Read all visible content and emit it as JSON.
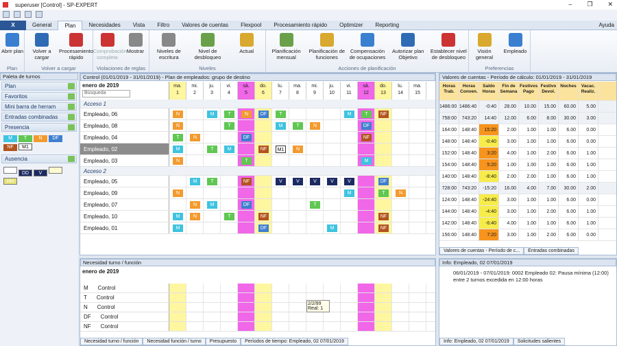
{
  "window": {
    "title": "superuser [Control] - SP-EXPERT"
  },
  "ribbon": {
    "file_label": "X",
    "tabs": [
      "General",
      "Plan",
      "Necesidades",
      "Vista",
      "Filtro",
      "Valores de cuentas",
      "Flexpool",
      "Procesamiento rápido",
      "Optimizer",
      "Reporting"
    ],
    "active_tab": "Plan",
    "help": "Ayuda",
    "groups": [
      {
        "label": "Plan",
        "buttons": [
          "Abrir plan"
        ]
      },
      {
        "label": "Volver a cargar",
        "buttons": [
          "Volver a cargar",
          "Procesamiento rápido"
        ]
      },
      {
        "label": "Violaciones de reglas",
        "buttons": [
          "Comprobación completa",
          "Mostrar"
        ]
      },
      {
        "label": "Niveles",
        "buttons": [
          "Niveles de escritura",
          "Nivel de desbloqueo",
          "Actual"
        ]
      },
      {
        "label": "Acciones de planificación",
        "buttons": [
          "Planificación mensual",
          "Planificación de funciones",
          "Compensación de ocupaciones",
          "Autorizar plan Objetivo",
          "Establecer nivel de desbloqueo"
        ]
      },
      {
        "label": "Preferencias",
        "buttons": [
          "Visión general",
          "Empleado"
        ]
      }
    ]
  },
  "left": {
    "title": "Paleta de turnos",
    "items": [
      "Plan",
      "Favoritos",
      "Mini barra de herram",
      "Entradas combinadas",
      "Presencia",
      "Ausencia"
    ],
    "presence_chips": [
      "M",
      "T",
      "N",
      "DF",
      "NF",
      "M1"
    ],
    "absence_chips": [
      "",
      "DD",
      "V",
      "",
      "HH"
    ]
  },
  "center": {
    "title": "Control (01/01/2019 - 31/01/2019) - Plan de empleados: grupo de destino",
    "month": "enero de 2019",
    "search_placeholder": "Búsqueda",
    "days": [
      [
        "ma.",
        "1"
      ],
      [
        "mi.",
        "2"
      ],
      [
        "ju.",
        "3"
      ],
      [
        "vi.",
        "4"
      ],
      [
        "sá.",
        "5"
      ],
      [
        "do.",
        "6"
      ],
      [
        "lu.",
        "7"
      ],
      [
        "ma.",
        "8"
      ],
      [
        "mi.",
        "9"
      ],
      [
        "ju.",
        "10"
      ],
      [
        "vi.",
        "11"
      ],
      [
        "sá.",
        "12"
      ],
      [
        "do.",
        "13"
      ],
      [
        "lu.",
        "14"
      ],
      [
        "ma.",
        "15"
      ]
    ],
    "groups": [
      {
        "name": "Acceso 1",
        "rows": [
          {
            "name": "Empleado, 06",
            "shifts": [
              "N",
              "",
              "M",
              "T",
              "N",
              "DF",
              "T",
              "",
              "",
              "",
              "M",
              "T",
              "NF",
              "",
              ""
            ]
          },
          {
            "name": "Empleado, 08",
            "shifts": [
              "N",
              "",
              "",
              "T",
              "",
              "",
              "M",
              "T",
              "N",
              "",
              "",
              "DF",
              "",
              "",
              ""
            ]
          },
          {
            "name": "Empleado, 04",
            "shifts": [
              "T",
              "N",
              "",
              "",
              "DF",
              "",
              "",
              "",
              "",
              "",
              "",
              "NF",
              "",
              "",
              ""
            ]
          },
          {
            "name": "Empleado, 02",
            "selected": true,
            "shifts": [
              "M",
              "",
              "T",
              "M",
              "",
              "NF",
              "M1",
              "N",
              "",
              "",
              "",
              "",
              "",
              "",
              ""
            ]
          },
          {
            "name": "Empleado, 03",
            "shifts": [
              "N",
              "",
              "",
              "",
              "T",
              "",
              "",
              "",
              "",
              "",
              "",
              "M",
              "",
              "",
              ""
            ]
          }
        ]
      },
      {
        "name": "Acceso 2",
        "rows": [
          {
            "name": "Empleado, 05",
            "shifts": [
              "",
              "M",
              "T",
              "",
              "NF",
              "",
              "V",
              "V",
              "V",
              "V",
              "V",
              "",
              "DF",
              "",
              ""
            ]
          },
          {
            "name": "Empleado, 09",
            "shifts": [
              "N",
              "",
              "",
              "",
              "",
              "",
              "",
              "",
              "",
              "",
              "M",
              "",
              "T",
              "N",
              ""
            ]
          },
          {
            "name": "Empleado, 07",
            "shifts": [
              "",
              "N",
              "M",
              "",
              "DF",
              "",
              "",
              "",
              "T",
              "",
              "",
              "",
              "",
              "",
              ""
            ]
          },
          {
            "name": "Empleado, 10",
            "shifts": [
              "M",
              "N",
              "",
              "T",
              "",
              "NF",
              "",
              "",
              "",
              "",
              "",
              "",
              "NF",
              "",
              ""
            ]
          },
          {
            "name": "Empleado, 01",
            "shifts": [
              "M",
              "",
              "",
              "",
              "",
              "DF",
              "",
              "",
              "",
              "M",
              "",
              "",
              "NF",
              "",
              ""
            ]
          }
        ]
      }
    ]
  },
  "values": {
    "title": "Valores de cuentas - Período de cálculo: 01/01/2019 - 31/01/2019",
    "headers": [
      "Horas Trab.",
      "Horas Conven.",
      "Saldo Horas",
      "Fin de Semana",
      "Festivos Pago",
      "Festivo Devol.",
      "Noches",
      "Vacac. Realiz."
    ],
    "rows": [
      [
        "1486:00",
        "1486:40",
        "-0:40",
        "28.00",
        "10.00",
        "15.00",
        "60.00",
        "5.00"
      ],
      [
        "758:00",
        "743:20",
        "14:40",
        "12.00",
        "6.00",
        "8.00",
        "30.00",
        "3.00"
      ],
      [
        "164:00",
        "148:40",
        "15:20",
        "2.00",
        "1.00",
        "1.00",
        "6.00",
        "0.00"
      ],
      [
        "148:00",
        "148:40",
        "-0:40",
        "3.00",
        "1.00",
        "1.00",
        "6.00",
        "0.00"
      ],
      [
        "152:00",
        "148:40",
        "3:20",
        "4.00",
        "1.00",
        "2.00",
        "6.00",
        "1.00"
      ],
      [
        "154:00",
        "148:40",
        "5:20",
        "1.00",
        "1.00",
        "1.00",
        "6.00",
        "1.00"
      ],
      [
        "140:00",
        "148:40",
        "-8:40",
        "2.00",
        "2.00",
        "1.00",
        "6.00",
        "1.00"
      ],
      [
        "728:00",
        "743:20",
        "-15:20",
        "16.00",
        "4.00",
        "7.00",
        "30.00",
        "2.00"
      ],
      [
        "124:00",
        "148:40",
        "-24:40",
        "3.00",
        "1.00",
        "1.00",
        "6.00",
        "0.00"
      ],
      [
        "144:00",
        "148:40",
        "-4:40",
        "3.00",
        "1.00",
        "2.00",
        "6.00",
        "1.00"
      ],
      [
        "142:00",
        "148:40",
        "-6:40",
        "4.00",
        "1.00",
        "1.00",
        "6.00",
        "1.00"
      ],
      [
        "156:00",
        "148:40",
        "7:20",
        "3.00",
        "1.00",
        "2.00",
        "6.00",
        "0.00"
      ]
    ],
    "tabs": [
      "Valores de cuentas - Período de c...",
      "Entradas combinadas"
    ]
  },
  "bottom": {
    "title": "Necesidad turno / función",
    "month": "enero de 2019",
    "rows": [
      [
        "M",
        "Control"
      ],
      [
        "T",
        "Control"
      ],
      [
        "N",
        "Control"
      ],
      [
        "DF",
        "Control"
      ],
      [
        "NF",
        "Control"
      ]
    ],
    "tooltip": "2/2/99 Real: 1",
    "tabs": [
      "Necesidad turno / función",
      "Necesidad función / turno",
      "Presupuesto",
      "Períodos de tiempo: Empleado, 02  07/01/2019"
    ]
  },
  "info": {
    "title": "Info: Empleado, 02  07/01/2019",
    "text": "06/01/2019 - 07/01/2019: 0002 Empleado 02: Pausa mínima (12:00) entre 2 turnos excedida en 12:00 horas",
    "tabs": [
      "Info: Empleado, 02  07/01/2019",
      "Solicitudes salientes"
    ]
  },
  "colors": {
    "M": "#3ec3e0",
    "T": "#5fc752",
    "N": "#f39a2e",
    "DF": "#3f7fcf",
    "NF": "#b2541f",
    "V": "#1c2a63",
    "M1": "#ffffff",
    "weekend": "#f067e8",
    "sunday": "#fff6a0"
  }
}
